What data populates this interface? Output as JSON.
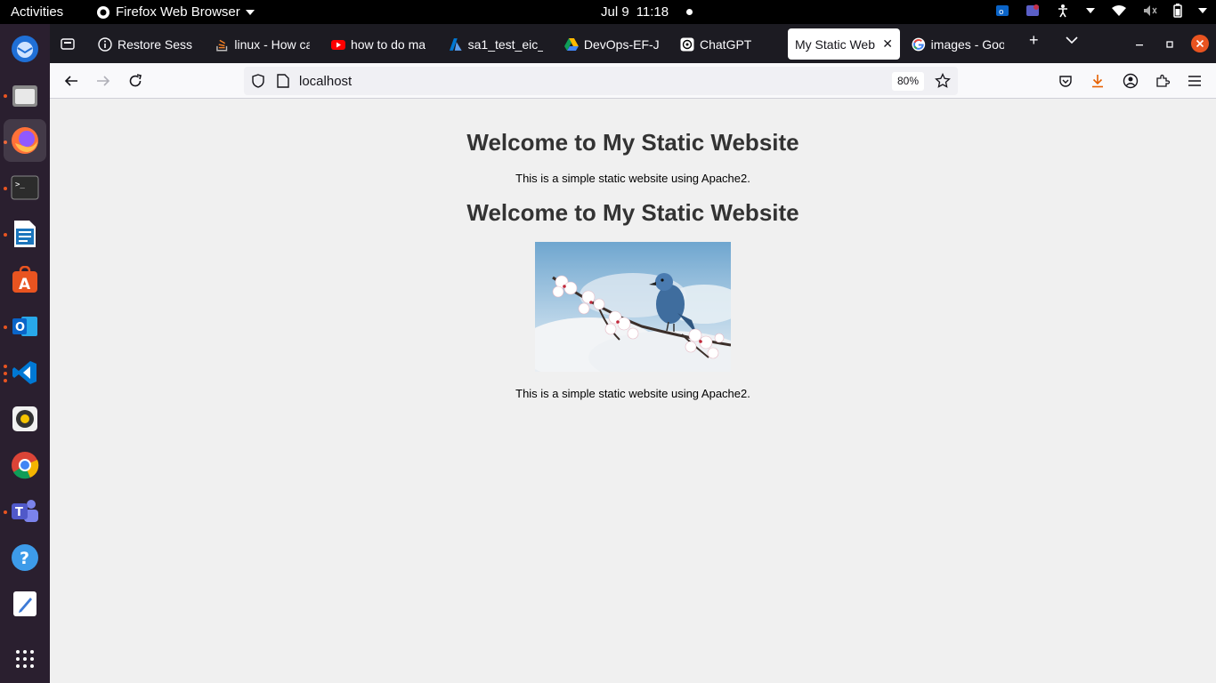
{
  "topbar": {
    "activities": "Activities",
    "app_name": "Firefox Web Browser",
    "date": "Jul 9",
    "time": "11:18"
  },
  "dock": {
    "items": [
      "Thunderbird Mail",
      "Files",
      "Firefox",
      "Terminal",
      "LibreOffice Writer",
      "Ubuntu Software",
      "Outlook",
      "Visual Studio Code",
      "Rhythmbox",
      "Google Chrome",
      "Microsoft Teams",
      "Help",
      "Text Editor"
    ]
  },
  "tabs": [
    {
      "label": "Restore Sess"
    },
    {
      "label": "linux - How ca"
    },
    {
      "label": "how to do ma"
    },
    {
      "label": "sa1_test_eic_"
    },
    {
      "label": "DevOps-EF-J"
    },
    {
      "label": "ChatGPT"
    },
    {
      "label": "My Static Web"
    },
    {
      "label": "images - Goo"
    }
  ],
  "navbar": {
    "url": "localhost",
    "zoom": "80%"
  },
  "page": {
    "heading1": "Welcome to My Static Website",
    "paragraph1": "This is a simple static website using Apache2.",
    "heading2": "Welcome to My Static Website",
    "image_alt": "Blue bird on cherry blossom branch",
    "paragraph2": "This is a simple static website using Apache2."
  },
  "colors": {
    "accent": "#e95420",
    "tabstrip": "#1c1b22",
    "page_bg": "#f0f0f0"
  }
}
